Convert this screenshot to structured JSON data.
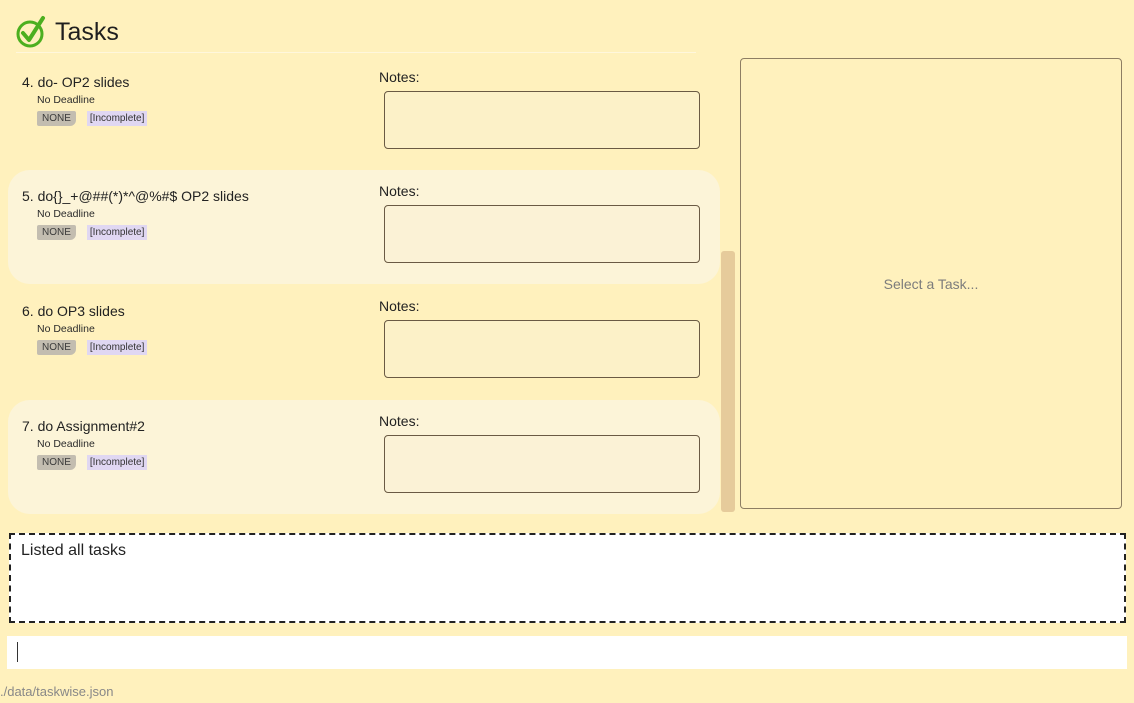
{
  "header": {
    "title": "Tasks",
    "logo_icon": "checkmark-circle-icon"
  },
  "tasks": [
    {
      "name": "4. do- OP2 slides",
      "deadline": "No Deadline",
      "priority": "NONE",
      "status": "[Incomplete]",
      "notes_label": "Notes:",
      "notes": ""
    },
    {
      "name": "5. do{}_+@##(*)*^@%#$ OP2 slides",
      "deadline": "No Deadline",
      "priority": "NONE",
      "status": "[Incomplete]",
      "notes_label": "Notes:",
      "notes": ""
    },
    {
      "name": "6. do OP3 slides",
      "deadline": "No Deadline",
      "priority": "NONE",
      "status": "[Incomplete]",
      "notes_label": "Notes:",
      "notes": ""
    },
    {
      "name": "7. do Assignment#2",
      "deadline": "No Deadline",
      "priority": "NONE",
      "status": "[Incomplete]",
      "notes_label": "Notes:",
      "notes": ""
    }
  ],
  "detail": {
    "placeholder": "Select a Task..."
  },
  "result": {
    "text": "Listed all tasks"
  },
  "command": {
    "value": ""
  },
  "status_bar": {
    "path": "./data/taskwise.json"
  },
  "colors": {
    "background": "#fff1bd",
    "alt_card": "#fcf4d8",
    "logo_green": "#4caf1f",
    "priority_badge": "#c3bdb0",
    "status_badge": "#e0d7f2",
    "scroll_thumb": "#e6cb9b"
  }
}
